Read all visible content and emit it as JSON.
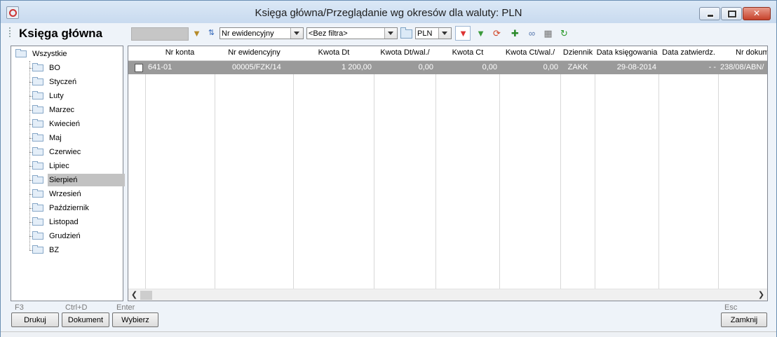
{
  "window": {
    "title": "Księga główna/Przeglądanie wg okresów dla waluty: PLN"
  },
  "toolbar": {
    "module_title": "Księga główna",
    "sort_combo": "Nr ewidencyjny",
    "filter_combo": "<Bez filtra>",
    "currency_combo": "PLN",
    "icons": [
      "filter-edit-icon",
      "sort-icon",
      "folder-icon",
      "filter-active-icon",
      "filter-icon",
      "refresh-icon",
      "add-document-icon",
      "link-icon",
      "table-icon",
      "reload-icon"
    ]
  },
  "tree": {
    "root": "Wszystkie",
    "items": [
      "BO",
      "Styczeń",
      "Luty",
      "Marzec",
      "Kwiecień",
      "Maj",
      "Czerwiec",
      "Lipiec",
      "Sierpień",
      "Wrzesień",
      "Październik",
      "Listopad",
      "Grudzień",
      "BZ"
    ],
    "selected": "Sierpień"
  },
  "grid": {
    "columns": [
      "Nr konta",
      "Nr ewidencyjny",
      "Kwota Dt",
      "Kwota Dt/wal./",
      "Kwota Ct",
      "Kwota Ct/wal./",
      "Dziennik",
      "Data księgowania",
      "Data zatwierdz.",
      "Nr dokum"
    ],
    "rows": [
      {
        "nr_konta": "641-01",
        "nr_ewidencyjny": "00005/FZK/14",
        "kwota_dt": "1 200,00",
        "kwota_dt_wal": "0,00",
        "kwota_ct": "0,00",
        "kwota_ct_wal": "0,00",
        "dziennik": "ZAKK",
        "data_ksiegowania": "29-08-2014",
        "data_zatwierdz": "- -",
        "nr_dokum": "238/08/ABN/"
      }
    ]
  },
  "footer": {
    "buttons": [
      {
        "hotkey": "F3",
        "label": "Drukuj"
      },
      {
        "hotkey": "Ctrl+D",
        "label": "Dokument"
      },
      {
        "hotkey": "Enter",
        "label": "Wybierz"
      },
      {
        "hotkey": "Esc",
        "label": "Zamknij"
      }
    ]
  },
  "colors": {
    "selected_row": "#9a9a9a",
    "selected_tree": "#c2c2c2",
    "titlebar": "#c8daef"
  }
}
